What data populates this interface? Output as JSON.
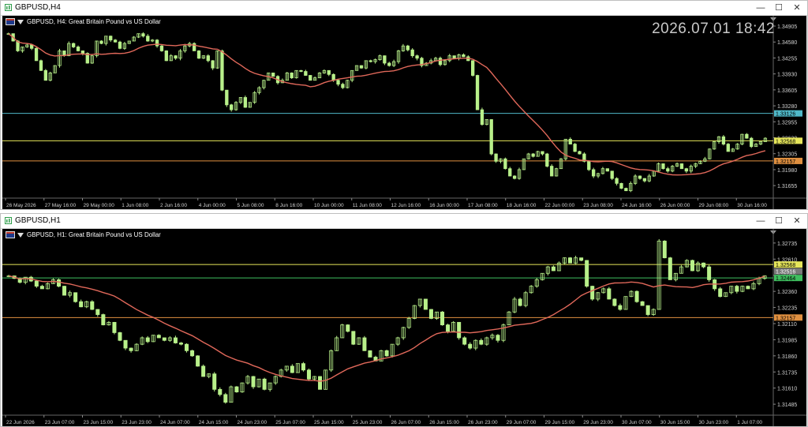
{
  "colors": {
    "bg": "#000000",
    "candle": "#b8f08a",
    "ma": "#e0685a",
    "axis_text": "#d0d0d0",
    "hline_cyan": "#4fb8c8",
    "hline_yellow": "#e6e65a",
    "hline_orange": "#e09040",
    "hline_green": "#3fbf5f"
  },
  "windows": [
    {
      "title": "GBPUSD,H4",
      "header": "GBPUSD, H4:  Great Britain Pound vs US Dollar",
      "timestamp": "2026.07.01 18:42",
      "buttons": {
        "minimize": "—",
        "maximize": "☐",
        "close": "✕"
      },
      "price_ticks": [
        "1.34905",
        "1.34580",
        "1.34255",
        "1.33930",
        "1.33605",
        "1.33280",
        "1.32955",
        "1.32630",
        "1.32305",
        "1.31980",
        "1.31655"
      ],
      "price_tick_values": [
        1.34905,
        1.3458,
        1.34255,
        1.3393,
        1.33605,
        1.3328,
        1.32955,
        1.3263,
        1.32305,
        1.3198,
        1.31655
      ],
      "hlines": [
        {
          "price": 1.33126,
          "label": "1.33126",
          "color": "#4fb8c8"
        },
        {
          "price": 1.32568,
          "label": "1.32568",
          "color": "#e6e65a"
        },
        {
          "price": 1.32157,
          "label": "1.32157",
          "color": "#e09040"
        }
      ],
      "time_labels": [
        "26 May 2026",
        "27 May 16:00",
        "29 May 00:00",
        "1 Jun 08:00",
        "2 Jun 16:00",
        "4 Jun 00:00",
        "5 Jun 08:00",
        "8 Jun 16:00",
        "10 Jun 00:00",
        "11 Jun 08:00",
        "12 Jun 16:00",
        "16 Jun 00:00",
        "17 Jun 08:00",
        "18 Jun 16:00",
        "22 Jun 00:00",
        "23 Jun 08:00",
        "24 Jun 16:00",
        "26 Jun 00:00",
        "29 Jun 08:00",
        "30 Jun 16:00"
      ],
      "ylim": [
        1.314,
        1.3505
      ],
      "closes": [
        1.3475,
        1.346,
        1.344,
        1.3448,
        1.3452,
        1.3445,
        1.342,
        1.34,
        1.338,
        1.3395,
        1.341,
        1.344,
        1.343,
        1.3455,
        1.3448,
        1.344,
        1.3435,
        1.3415,
        1.343,
        1.346,
        1.3455,
        1.347,
        1.3462,
        1.3458,
        1.3445,
        1.3455,
        1.346,
        1.3468,
        1.3475,
        1.347,
        1.346,
        1.3462,
        1.345,
        1.344,
        1.342,
        1.343,
        1.3425,
        1.344,
        1.345,
        1.3455,
        1.344,
        1.3425,
        1.343,
        1.342,
        1.3405,
        1.344,
        1.336,
        1.333,
        1.332,
        1.3335,
        1.3345,
        1.3325,
        1.3335,
        1.3355,
        1.3365,
        1.338,
        1.3395,
        1.3388,
        1.3375,
        1.338,
        1.3395,
        1.3385,
        1.34,
        1.3398,
        1.339,
        1.338,
        1.3385,
        1.3395,
        1.34,
        1.3392,
        1.338,
        1.3372,
        1.3365,
        1.338,
        1.34,
        1.341,
        1.3405,
        1.342,
        1.3418,
        1.3422,
        1.343,
        1.3415,
        1.341,
        1.3418,
        1.344,
        1.345,
        1.3442,
        1.343,
        1.3425,
        1.341,
        1.3415,
        1.342,
        1.3425,
        1.3412,
        1.342,
        1.343,
        1.3425,
        1.3432,
        1.3428,
        1.342,
        1.339,
        1.332,
        1.329,
        1.33,
        1.323,
        1.3215,
        1.322,
        1.32,
        1.3185,
        1.318,
        1.3198,
        1.322,
        1.323,
        1.3225,
        1.3235,
        1.323,
        1.3205,
        1.3185,
        1.32,
        1.322,
        1.326,
        1.325,
        1.3235,
        1.323,
        1.3215,
        1.3198,
        1.3185,
        1.319,
        1.32,
        1.3195,
        1.318,
        1.317,
        1.316,
        1.3155,
        1.317,
        1.3185,
        1.318,
        1.3175,
        1.3185,
        1.3195,
        1.321,
        1.32,
        1.3195,
        1.3205,
        1.321,
        1.32,
        1.3195,
        1.3205,
        1.321,
        1.3215,
        1.322,
        1.324,
        1.3255,
        1.3265,
        1.325,
        1.3235,
        1.324,
        1.325,
        1.327,
        1.3262,
        1.3245,
        1.325,
        1.3255,
        1.3262
      ],
      "ma_period": 20
    },
    {
      "title": "GBPUSD,H1",
      "header": "GBPUSD, H1:  Great Britain Pound vs US Dollar",
      "buttons": {
        "minimize": "—",
        "maximize": "☐",
        "close": "✕"
      },
      "price_ticks": [
        "1.32735",
        "1.32610",
        "1.32485",
        "1.32360",
        "1.32235",
        "1.32110",
        "1.31985",
        "1.31860",
        "1.31735",
        "1.31610",
        "1.31485"
      ],
      "price_tick_values": [
        1.32735,
        1.3261,
        1.32485,
        1.3236,
        1.32235,
        1.3211,
        1.31985,
        1.3186,
        1.31735,
        1.3161,
        1.31485
      ],
      "hlines": [
        {
          "price": 1.32568,
          "label": "1.32568",
          "color": "#e6e65a"
        },
        {
          "price": 1.32464,
          "label": "1.32464",
          "color": "#3fbf5f"
        },
        {
          "price": 1.32157,
          "label": "1.32157",
          "color": "#e09040"
        }
      ],
      "extra_tick_label": "1.32516",
      "time_labels": [
        "22 Jun 2026",
        "23 Jun 07:00",
        "23 Jun 15:00",
        "23 Jun 23:00",
        "24 Jun 07:00",
        "24 Jun 15:00",
        "24 Jun 23:00",
        "25 Jun 07:00",
        "25 Jun 15:00",
        "25 Jun 23:00",
        "26 Jun 07:00",
        "26 Jun 15:00",
        "26 Jun 23:00",
        "29 Jun 07:00",
        "29 Jun 15:00",
        "29 Jun 23:00",
        "30 Jun 07:00",
        "30 Jun 15:00",
        "30 Jun 23:00",
        "1 Jul 07:00"
      ],
      "ylim": [
        1.314,
        1.3282
      ],
      "closes": [
        1.3248,
        1.3246,
        1.3243,
        1.3247,
        1.3244,
        1.324,
        1.3238,
        1.3242,
        1.3245,
        1.324,
        1.3233,
        1.3235,
        1.3228,
        1.3224,
        1.3228,
        1.3222,
        1.3218,
        1.321,
        1.3212,
        1.3204,
        1.3198,
        1.3192,
        1.319,
        1.3195,
        1.32,
        1.3197,
        1.3202,
        1.32,
        1.3198,
        1.32,
        1.3196,
        1.3195,
        1.319,
        1.3186,
        1.3178,
        1.317,
        1.3172,
        1.316,
        1.3156,
        1.315,
        1.3162,
        1.3158,
        1.3165,
        1.317,
        1.3162,
        1.3168,
        1.316,
        1.3165,
        1.317,
        1.3175,
        1.3178,
        1.3173,
        1.318,
        1.3175,
        1.3168,
        1.317,
        1.316,
        1.3175,
        1.319,
        1.32,
        1.321,
        1.3205,
        1.3195,
        1.32,
        1.319,
        1.3185,
        1.3182,
        1.319,
        1.3186,
        1.3195,
        1.32,
        1.3208,
        1.3215,
        1.3225,
        1.323,
        1.3222,
        1.3215,
        1.322,
        1.321,
        1.3205,
        1.3212,
        1.32,
        1.3195,
        1.3192,
        1.3198,
        1.3195,
        1.32,
        1.3202,
        1.3198,
        1.321,
        1.322,
        1.323,
        1.3225,
        1.3235,
        1.324,
        1.3245,
        1.325,
        1.3255,
        1.3252,
        1.3258,
        1.3262,
        1.3258,
        1.3262,
        1.326,
        1.324,
        1.323,
        1.3235,
        1.3238,
        1.323,
        1.3225,
        1.3222,
        1.3232,
        1.3236,
        1.3228,
        1.3225,
        1.3218,
        1.3222,
        1.3275,
        1.3262,
        1.3245,
        1.325,
        1.3255,
        1.326,
        1.3252,
        1.3258,
        1.3255,
        1.3245,
        1.3238,
        1.3232,
        1.3235,
        1.324,
        1.3236,
        1.324,
        1.3238,
        1.3242,
        1.3246,
        1.3248
      ],
      "ma_period": 20
    }
  ]
}
